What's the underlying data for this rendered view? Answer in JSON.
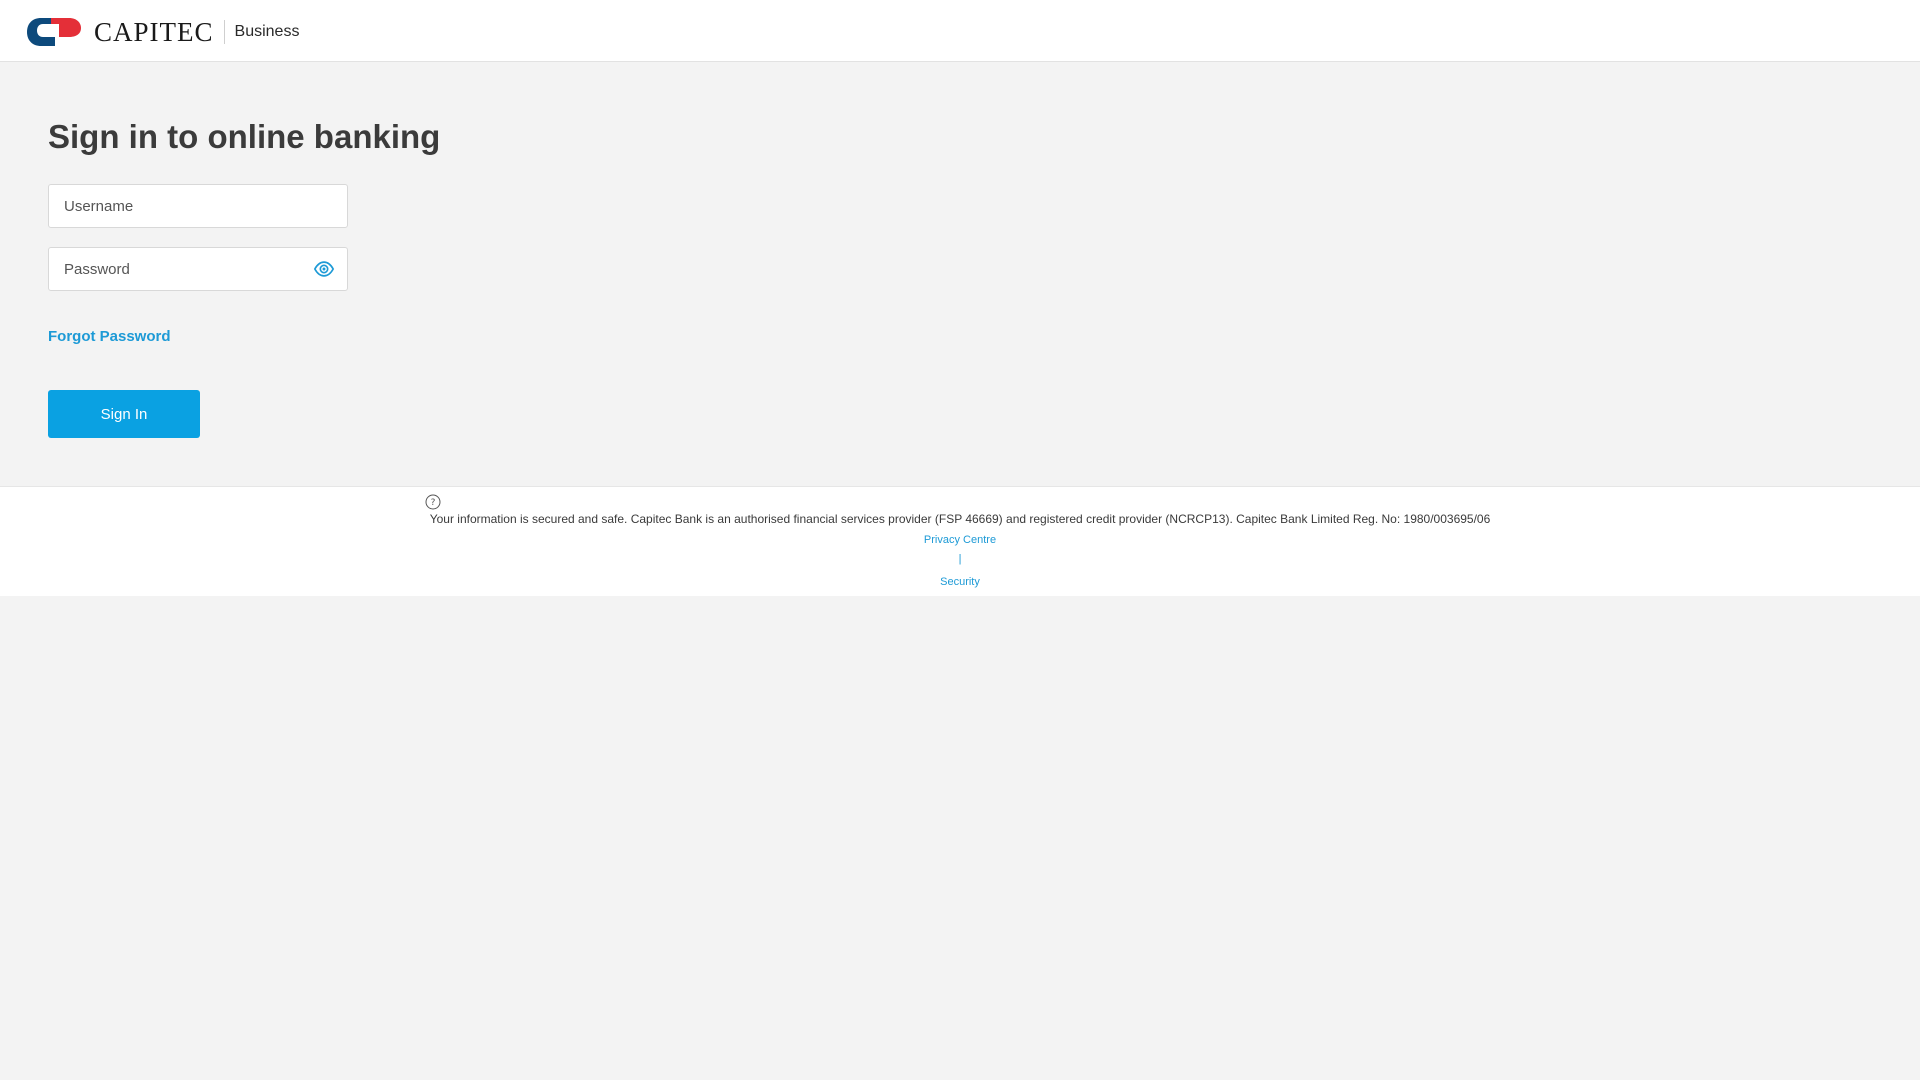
{
  "header": {
    "brand": "CAPITEC",
    "sub_brand": "Business"
  },
  "main": {
    "title": "Sign in to online banking",
    "username_placeholder": "Username",
    "password_placeholder": "Password",
    "forgot_password": "Forgot Password",
    "sign_in": "Sign In"
  },
  "footer": {
    "info_text": "Your information is secured and safe. Capitec Bank is an authorised financial services provider (FSP 46669) and registered credit provider (NCRCP13). Capitec Bank Limited Reg. No: 1980/003695/06",
    "privacy_link": "Privacy Centre",
    "separator": "|",
    "security_link": "Security"
  },
  "colors": {
    "accent": "#0aa1e2",
    "link": "#1d9ad6",
    "logo_red": "#e42f38",
    "logo_navy": "#0d4a7c",
    "background": "#f3f3f3"
  },
  "icons": {
    "password_toggle": "eye-icon",
    "footer_info": "info-icon"
  }
}
